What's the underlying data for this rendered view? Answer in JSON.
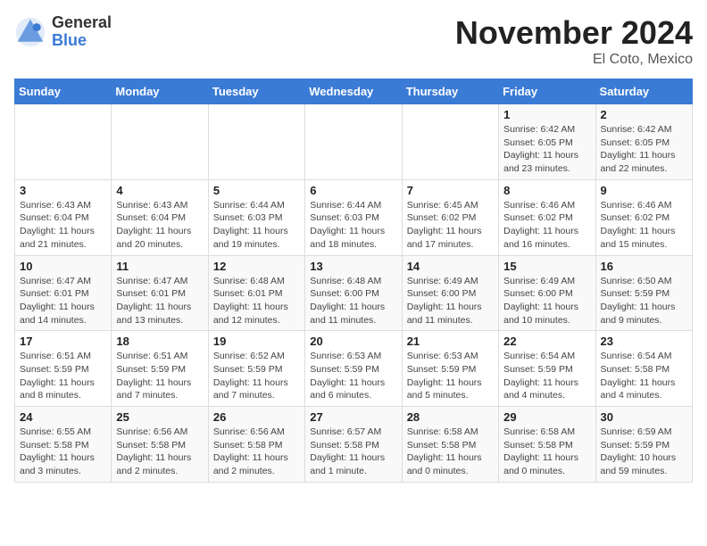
{
  "header": {
    "logo_general": "General",
    "logo_blue": "Blue",
    "month_title": "November 2024",
    "location": "El Coto, Mexico"
  },
  "weekdays": [
    "Sunday",
    "Monday",
    "Tuesday",
    "Wednesday",
    "Thursday",
    "Friday",
    "Saturday"
  ],
  "weeks": [
    [
      {
        "day": "",
        "detail": ""
      },
      {
        "day": "",
        "detail": ""
      },
      {
        "day": "",
        "detail": ""
      },
      {
        "day": "",
        "detail": ""
      },
      {
        "day": "",
        "detail": ""
      },
      {
        "day": "1",
        "detail": "Sunrise: 6:42 AM\nSunset: 6:05 PM\nDaylight: 11 hours and 23 minutes."
      },
      {
        "day": "2",
        "detail": "Sunrise: 6:42 AM\nSunset: 6:05 PM\nDaylight: 11 hours and 22 minutes."
      }
    ],
    [
      {
        "day": "3",
        "detail": "Sunrise: 6:43 AM\nSunset: 6:04 PM\nDaylight: 11 hours and 21 minutes."
      },
      {
        "day": "4",
        "detail": "Sunrise: 6:43 AM\nSunset: 6:04 PM\nDaylight: 11 hours and 20 minutes."
      },
      {
        "day": "5",
        "detail": "Sunrise: 6:44 AM\nSunset: 6:03 PM\nDaylight: 11 hours and 19 minutes."
      },
      {
        "day": "6",
        "detail": "Sunrise: 6:44 AM\nSunset: 6:03 PM\nDaylight: 11 hours and 18 minutes."
      },
      {
        "day": "7",
        "detail": "Sunrise: 6:45 AM\nSunset: 6:02 PM\nDaylight: 11 hours and 17 minutes."
      },
      {
        "day": "8",
        "detail": "Sunrise: 6:46 AM\nSunset: 6:02 PM\nDaylight: 11 hours and 16 minutes."
      },
      {
        "day": "9",
        "detail": "Sunrise: 6:46 AM\nSunset: 6:02 PM\nDaylight: 11 hours and 15 minutes."
      }
    ],
    [
      {
        "day": "10",
        "detail": "Sunrise: 6:47 AM\nSunset: 6:01 PM\nDaylight: 11 hours and 14 minutes."
      },
      {
        "day": "11",
        "detail": "Sunrise: 6:47 AM\nSunset: 6:01 PM\nDaylight: 11 hours and 13 minutes."
      },
      {
        "day": "12",
        "detail": "Sunrise: 6:48 AM\nSunset: 6:01 PM\nDaylight: 11 hours and 12 minutes."
      },
      {
        "day": "13",
        "detail": "Sunrise: 6:48 AM\nSunset: 6:00 PM\nDaylight: 11 hours and 11 minutes."
      },
      {
        "day": "14",
        "detail": "Sunrise: 6:49 AM\nSunset: 6:00 PM\nDaylight: 11 hours and 11 minutes."
      },
      {
        "day": "15",
        "detail": "Sunrise: 6:49 AM\nSunset: 6:00 PM\nDaylight: 11 hours and 10 minutes."
      },
      {
        "day": "16",
        "detail": "Sunrise: 6:50 AM\nSunset: 5:59 PM\nDaylight: 11 hours and 9 minutes."
      }
    ],
    [
      {
        "day": "17",
        "detail": "Sunrise: 6:51 AM\nSunset: 5:59 PM\nDaylight: 11 hours and 8 minutes."
      },
      {
        "day": "18",
        "detail": "Sunrise: 6:51 AM\nSunset: 5:59 PM\nDaylight: 11 hours and 7 minutes."
      },
      {
        "day": "19",
        "detail": "Sunrise: 6:52 AM\nSunset: 5:59 PM\nDaylight: 11 hours and 7 minutes."
      },
      {
        "day": "20",
        "detail": "Sunrise: 6:53 AM\nSunset: 5:59 PM\nDaylight: 11 hours and 6 minutes."
      },
      {
        "day": "21",
        "detail": "Sunrise: 6:53 AM\nSunset: 5:59 PM\nDaylight: 11 hours and 5 minutes."
      },
      {
        "day": "22",
        "detail": "Sunrise: 6:54 AM\nSunset: 5:59 PM\nDaylight: 11 hours and 4 minutes."
      },
      {
        "day": "23",
        "detail": "Sunrise: 6:54 AM\nSunset: 5:58 PM\nDaylight: 11 hours and 4 minutes."
      }
    ],
    [
      {
        "day": "24",
        "detail": "Sunrise: 6:55 AM\nSunset: 5:58 PM\nDaylight: 11 hours and 3 minutes."
      },
      {
        "day": "25",
        "detail": "Sunrise: 6:56 AM\nSunset: 5:58 PM\nDaylight: 11 hours and 2 minutes."
      },
      {
        "day": "26",
        "detail": "Sunrise: 6:56 AM\nSunset: 5:58 PM\nDaylight: 11 hours and 2 minutes."
      },
      {
        "day": "27",
        "detail": "Sunrise: 6:57 AM\nSunset: 5:58 PM\nDaylight: 11 hours and 1 minute."
      },
      {
        "day": "28",
        "detail": "Sunrise: 6:58 AM\nSunset: 5:58 PM\nDaylight: 11 hours and 0 minutes."
      },
      {
        "day": "29",
        "detail": "Sunrise: 6:58 AM\nSunset: 5:58 PM\nDaylight: 11 hours and 0 minutes."
      },
      {
        "day": "30",
        "detail": "Sunrise: 6:59 AM\nSunset: 5:59 PM\nDaylight: 10 hours and 59 minutes."
      }
    ]
  ]
}
